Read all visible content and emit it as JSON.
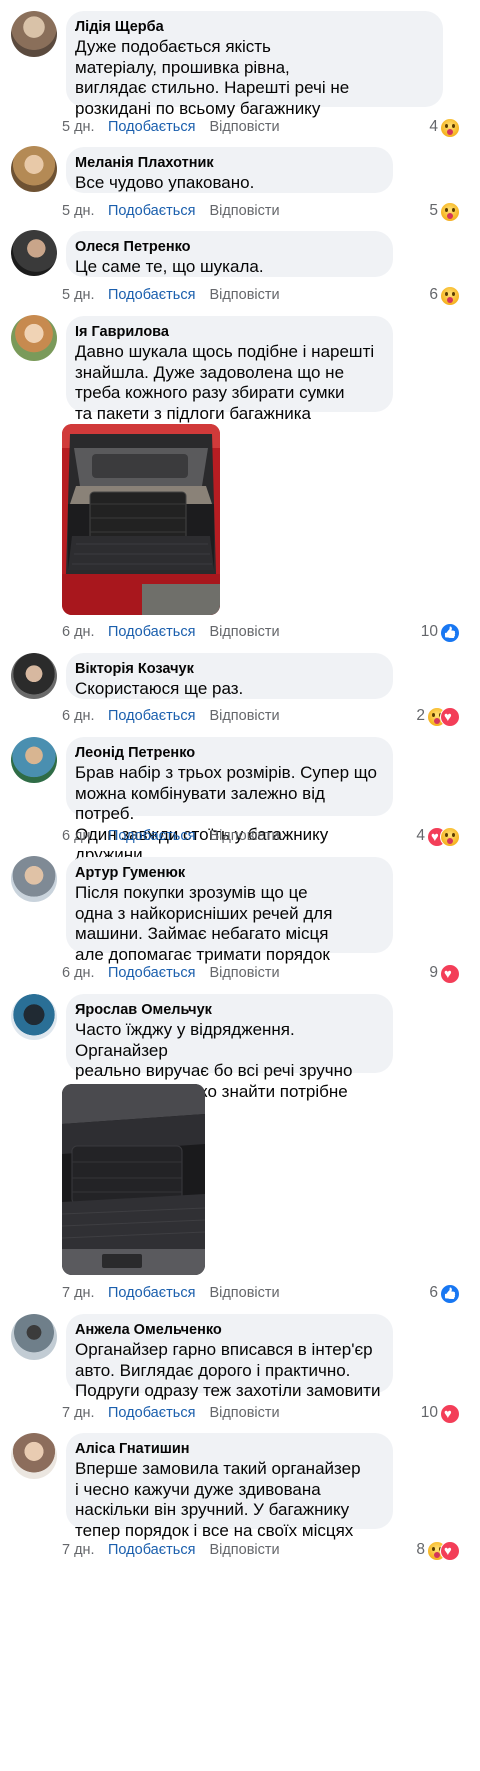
{
  "comments": [
    {
      "author": "Лідія Щерба",
      "text": "Дуже подобається якість\nматеріалу, прошивка рівна,\nвиглядає стильно. Нарешті речі не\nрозкидані по всьому багажнику",
      "time": "5 дн.",
      "like_label": "Подобається",
      "reply_label": "Відповісти",
      "reaction_count": "4",
      "reactions": [
        "wow-icon"
      ],
      "avatar_color": "#8a6f5a"
    },
    {
      "author": "Меланія Плахотник",
      "text": "Все чудово упаковано.",
      "time": "5 дн.",
      "like_label": "Подобається",
      "reply_label": "Відповісти",
      "reaction_count": "5",
      "reactions": [
        "wow-icon"
      ],
      "avatar_color": "#b48a55"
    },
    {
      "author": "Олеся Петренко",
      "text": "Це саме те, що шукала.",
      "time": "5 дн.",
      "like_label": "Подобається",
      "reply_label": "Відповісти",
      "reaction_count": "6",
      "reactions": [
        "wow-icon"
      ],
      "avatar_color": "#3a3a3a"
    },
    {
      "author": "Ія Гаврилова",
      "text": "Давно шукала щось подібне і нарешті\nзнайшла. Дуже задоволена що не\nтреба кожного разу збирати сумки\nта пакети з підлоги багажника",
      "time": "6 дн.",
      "like_label": "Подобається",
      "reply_label": "Відповісти",
      "reaction_count": "10",
      "reactions": [
        "like-icon"
      ],
      "avatar_color": "#7a9a5a",
      "has_photo": true
    },
    {
      "author": "Вікторія Козачук",
      "text": "Скористаюся ще раз.",
      "time": "6 дн.",
      "like_label": "Подобається",
      "reply_label": "Відповісти",
      "reaction_count": "2",
      "reactions": [
        "wow-icon",
        "love-icon"
      ],
      "avatar_color": "#2b2b2b"
    },
    {
      "author": "Леонід Петренко",
      "text": "Брав набір з трьох розмірів. Супер що\nможна комбінувати залежно від потреб.\nОдин завжди стоїть у багажнику дружини",
      "time": "6 дн.",
      "like_label": "Подобається",
      "reply_label": "Відповісти",
      "reaction_count": "4",
      "reactions": [
        "love-icon",
        "wow-icon"
      ],
      "avatar_color": "#4a8fb0"
    },
    {
      "author": "Артур Гуменюк",
      "text": "Після покупки зрозумів що це\nодна з найкорисніших речей для\nмашини. Займає небагато місця\nале допомагає тримати порядок",
      "time": "6 дн.",
      "like_label": "Подобається",
      "reply_label": "Відповісти",
      "reaction_count": "9",
      "reactions": [
        "love-icon"
      ],
      "avatar_color": "#7f8a95"
    },
    {
      "author": "Ярослав Омельчук",
      "text": "Часто їжджу у відрядження. Органайзер\nреально виручає бо всі речі зручно\nрозкладені і легко знайти потрібне",
      "time": "7 дн.",
      "like_label": "Подобається",
      "reply_label": "Відповісти",
      "reaction_count": "6",
      "reactions": [
        "like-icon"
      ],
      "avatar_color": "#2a6f96",
      "has_photo": true
    },
    {
      "author": "Анжела Омельченко",
      "text": "Органайзер гарно вписався в інтер'єр\nавто. Виглядає дорого і практично.\nПодруги одразу теж захотіли замовити",
      "time": "7 дн.",
      "like_label": "Подобається",
      "reply_label": "Відповісти",
      "reaction_count": "10",
      "reactions": [
        "love-icon"
      ],
      "avatar_color": "#6f7f8a"
    },
    {
      "author": "Аліса Гнатишин",
      "text": "Вперше замовила такий органайзер\nі чесно кажучи дуже здивована\nнаскільки він зручний. У багажнику\nтепер порядок і все на своїх місцях",
      "time": "7 дн.",
      "like_label": "Подобається",
      "reply_label": "Відповісти",
      "reaction_count": "8",
      "reactions": [
        "wow-icon",
        "love-icon"
      ],
      "avatar_color": "#8c6d5c"
    }
  ]
}
